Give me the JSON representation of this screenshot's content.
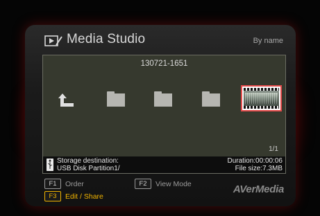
{
  "header": {
    "title": "Media Studio",
    "sort_mode": "By name"
  },
  "browser": {
    "current_folder": "130721-1651",
    "items": [
      {
        "type": "up",
        "icon": "up-arrow-icon"
      },
      {
        "type": "folder",
        "icon": "folder-icon"
      },
      {
        "type": "folder",
        "icon": "folder-icon"
      },
      {
        "type": "folder",
        "icon": "folder-icon"
      },
      {
        "type": "video",
        "icon": "video-thumbnail",
        "selected": true
      }
    ],
    "page": "1/1"
  },
  "info_bar": {
    "storage_label": "Storage destination:",
    "storage_value": "USB Disk Partition1/",
    "duration": "Duration:00:00:06",
    "file_size": "File size:7.3MB"
  },
  "keys": {
    "f1_key": "F1",
    "f1_label": "Order",
    "f2_key": "F2",
    "f2_label": "View Mode",
    "f3_key": "F3",
    "f3_label": "Edit / Share"
  },
  "brand": "AVerMedia",
  "colors": {
    "highlight": "#f1b400",
    "selection_border": "#e34a4a",
    "glow": "#a00000"
  }
}
